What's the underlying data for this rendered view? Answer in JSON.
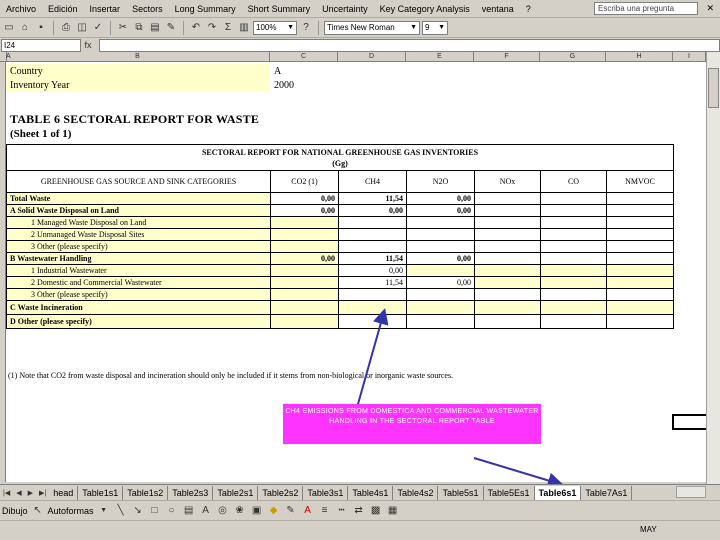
{
  "menu": [
    "Archivo",
    "Edición",
    "Insertar",
    "Sectors",
    "Long Summary",
    "Short Summary",
    "Uncertainty",
    "Key Category Analysis",
    "ventana",
    "?"
  ],
  "help_placeholder": "Escriba una pregunta",
  "toolbar": {
    "zoom": "100%",
    "font": "Times New Roman",
    "size": "9"
  },
  "namebox": "I24",
  "columns": [
    "A",
    "B",
    "C",
    "D",
    "E",
    "F",
    "G",
    "H",
    "I"
  ],
  "meta": {
    "country_label": "Country",
    "country_value": "A",
    "year_label": "Inventory Year",
    "year_value": "2000"
  },
  "table_title": "TABLE 6 SECTORAL REPORT FOR WASTE",
  "sheet_of": "(Sheet 1 of 1)",
  "report": {
    "title_line1": "SECTORAL REPORT FOR NATIONAL GREENHOUSE GAS INVENTORIES",
    "title_line2": "(Gg)",
    "category_header": "GREENHOUSE GAS SOURCE AND SINK CATEGORIES",
    "gases": [
      "CO2 (1)",
      "CH4",
      "N2O",
      "NOx",
      "CO",
      "NMVOC"
    ],
    "rows": [
      {
        "label": "Total Waste",
        "co2": "0,00",
        "ch4": "11,54",
        "n2o": "0,00"
      },
      {
        "label": "A Solid Waste Disposal on Land",
        "co2": "0,00",
        "ch4": "0,00",
        "n2o": "0,00"
      },
      {
        "label": "1 Managed Waste Disposal on Land",
        "co2": "",
        "ch4": "",
        "n2o": ""
      },
      {
        "label": "2 Unmanaged Waste Disposal Sites",
        "co2": "",
        "ch4": "",
        "n2o": ""
      },
      {
        "label": "3 Other (please specify)",
        "co2": "",
        "ch4": "",
        "n2o": ""
      },
      {
        "label": "B Wastewater Handling",
        "co2": "0,00",
        "ch4": "11,54",
        "n2o": "0,00"
      },
      {
        "label": "1 Industrial Wastewater",
        "co2": "",
        "ch4": "0,00",
        "n2o": ""
      },
      {
        "label": "2 Domestic and Commercial Wastewater",
        "co2": "",
        "ch4": "11,54",
        "n2o": "0,00"
      },
      {
        "label": "3 Other (please specify)",
        "co2": "",
        "ch4": "",
        "n2o": ""
      },
      {
        "label": "C Waste Incineration",
        "co2": "",
        "ch4": "",
        "n2o": ""
      },
      {
        "label": "D Other (please specify)",
        "co2": "",
        "ch4": "",
        "n2o": ""
      }
    ]
  },
  "footnote": "(1) Note that CO2 from waste disposal and incineration should only be included if it stems from non-biological or inorganic waste sources.",
  "callout": "CH4 EMISSIONS FROM DOMESTICA AND COMMERCIAL WASTEWATER HANDLING IN THE SECTORAL REPORT TABLE",
  "tabs": [
    "head",
    "Table1s1",
    "Table1s2",
    "Table2s3",
    "Table2s1",
    "Table2s2",
    "Table3s1",
    "Table4s1",
    "Table4s2",
    "Table5s1",
    "Table5Es1",
    "Table6s1",
    "Table7As1"
  ],
  "active_tab": "Table6s1",
  "drawing": {
    "draw_label": "Dibujo",
    "autoshapes_label": "Autoformas"
  },
  "status": {
    "mayus": "MAY"
  },
  "colors": {
    "highlight": "#ffffcc",
    "callout": "#ff33ff",
    "arrow": "#3333aa"
  }
}
